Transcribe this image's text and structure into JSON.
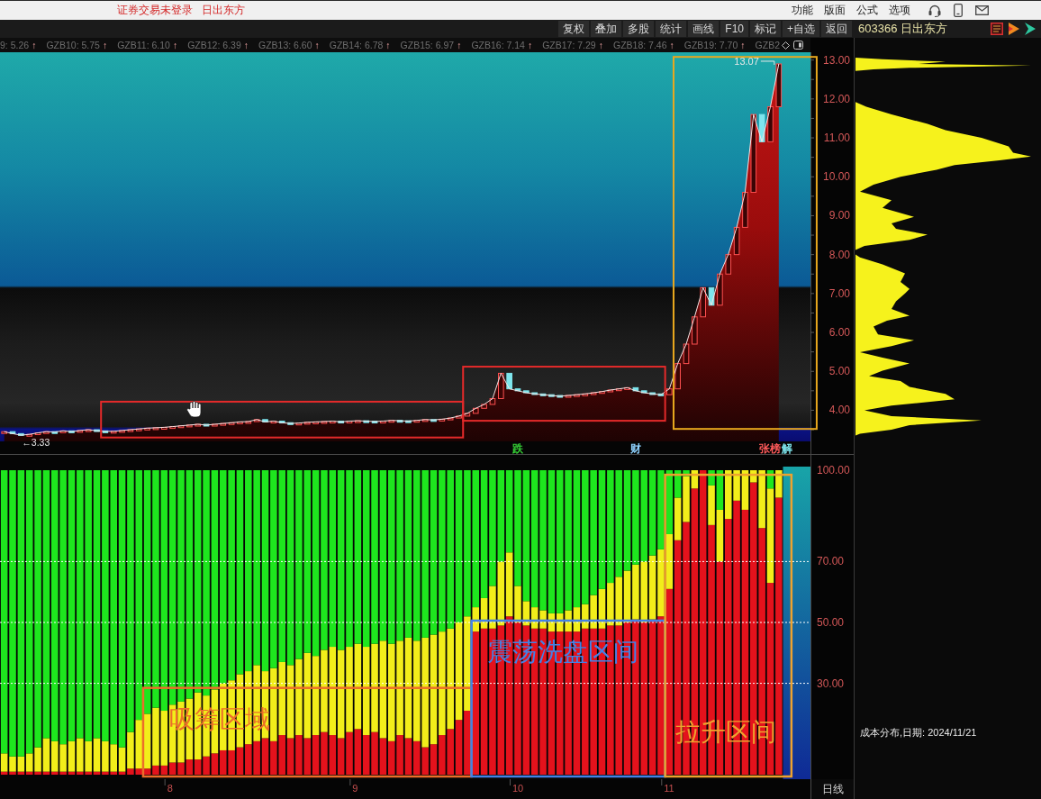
{
  "title_bar": {
    "status": "证券交易未登录",
    "stock_name": "日出东方",
    "menu": [
      "功能",
      "版面",
      "公式",
      "选项"
    ]
  },
  "toolbar": {
    "buttons": [
      "复权",
      "叠加",
      "多股",
      "统计",
      "画线",
      "F10",
      "标记",
      "+自选",
      "返回"
    ]
  },
  "indicator_line": {
    "items": [
      {
        "text": "9: 5.26",
        "arrow": "↑"
      },
      {
        "text": "GZB10: 5.75",
        "arrow": "↑"
      },
      {
        "text": "GZB11: 6.10",
        "arrow": "↑"
      },
      {
        "text": "GZB12: 6.39",
        "arrow": "↑"
      },
      {
        "text": "GZB13: 6.60",
        "arrow": "↑"
      },
      {
        "text": "GZB14: 6.78",
        "arrow": "↑"
      },
      {
        "text": "GZB15: 6.97",
        "arrow": "↑"
      },
      {
        "text": "GZB16: 7.14",
        "arrow": "↑"
      },
      {
        "text": "GZB17: 7.29",
        "arrow": "↑"
      },
      {
        "text": "GZB18: 7.46",
        "arrow": "↑"
      },
      {
        "text": "GZB19: 7.70",
        "arrow": "↑"
      },
      {
        "text": "GZB2"
      }
    ]
  },
  "price_chart": {
    "chart_data": {
      "type": "area",
      "ylim": [
        3.2,
        13.2
      ],
      "yticks": [
        {
          "value": 13,
          "label": "13.00"
        },
        {
          "value": 12,
          "label": "12.00"
        },
        {
          "value": 11,
          "label": "11.00"
        },
        {
          "value": 10,
          "label": "10.00"
        },
        {
          "value": 9,
          "label": "9.00"
        },
        {
          "value": 8,
          "label": "8.00"
        },
        {
          "value": 7,
          "label": "7.00"
        },
        {
          "value": 6,
          "label": "6.00"
        },
        {
          "value": 5,
          "label": "5.00"
        },
        {
          "value": 4,
          "label": "4.00"
        }
      ],
      "series": [
        {
          "color": "#f4e4e4",
          "values": [
            3.45,
            3.4,
            3.36,
            3.38,
            3.42,
            3.45,
            3.44,
            3.47,
            3.45,
            3.48,
            3.5,
            3.47,
            3.46,
            3.46,
            3.48,
            3.5,
            3.52,
            3.54,
            3.55,
            3.56,
            3.58,
            3.6,
            3.62,
            3.64,
            3.62,
            3.64,
            3.66,
            3.68,
            3.7,
            3.71,
            3.76,
            3.7,
            3.72,
            3.68,
            3.66,
            3.67,
            3.69,
            3.7,
            3.71,
            3.72,
            3.7,
            3.72,
            3.73,
            3.72,
            3.71,
            3.72,
            3.74,
            3.73,
            3.72,
            3.74,
            3.76,
            3.75,
            3.77,
            3.8,
            3.85,
            3.92,
            4.05,
            4.15,
            4.3,
            4.95,
            4.55,
            4.5,
            4.45,
            4.42,
            4.4,
            4.38,
            4.36,
            4.38,
            4.4,
            4.42,
            4.45,
            4.48,
            4.52,
            4.55,
            4.58,
            4.5,
            4.45,
            4.42,
            4.4,
            4.55,
            5.2,
            5.7,
            6.4,
            7.15,
            6.7,
            7.5,
            8.0,
            8.7,
            9.6,
            11.6,
            10.9,
            11.8,
            12.9
          ]
        }
      ]
    },
    "high_label": "13.07",
    "low_label": "←3.33",
    "highlight_boxes": [
      {
        "color": "#e42a2a"
      },
      {
        "color": "#e42a2a"
      },
      {
        "color": "#e8a81e"
      }
    ],
    "events": [
      {
        "text": "跌",
        "color": "#36d236"
      },
      {
        "text": "财",
        "color": "#8fd2ff"
      },
      {
        "text": "张榜",
        "color": "#ff5a5a"
      },
      {
        "text": "解",
        "color": "#7fe8f0"
      }
    ]
  },
  "ratio_chart": {
    "chart_data": {
      "type": "bar",
      "stacked": true,
      "grid": true,
      "ylim": [
        0,
        100
      ],
      "yticks": [
        {
          "value": 100,
          "label": "100.00"
        },
        {
          "value": 70,
          "label": "70.00"
        },
        {
          "value": 50,
          "label": "50.00"
        },
        {
          "value": 30,
          "label": "30.00"
        }
      ],
      "series": [
        {
          "color": "#e4121c",
          "values": [
            1,
            1,
            1,
            1,
            1,
            1,
            1,
            1,
            1,
            1,
            1,
            1,
            1,
            1,
            1,
            2,
            2,
            2,
            3,
            3,
            4,
            4,
            5,
            5,
            6,
            7,
            8,
            8,
            9,
            10,
            11,
            12,
            11,
            13,
            12,
            13,
            12,
            13,
            14,
            13,
            12,
            14,
            15,
            13,
            14,
            12,
            11,
            13,
            12,
            11,
            9,
            10,
            13,
            15,
            18,
            21,
            47,
            48,
            48,
            49,
            52,
            50,
            49,
            48,
            48,
            47,
            47,
            47,
            47,
            48,
            48,
            48,
            49,
            49,
            50,
            51,
            50,
            51,
            52,
            61,
            77,
            83,
            94,
            100,
            82,
            70,
            84,
            90,
            87,
            96,
            81,
            63,
            91
          ]
        },
        {
          "color": "#f2ee1a",
          "values": [
            6,
            5,
            5,
            6,
            8,
            11,
            10,
            9,
            10,
            11,
            10,
            11,
            10,
            9,
            8,
            12,
            16,
            18,
            19,
            18,
            19,
            20,
            20,
            22,
            20,
            21,
            22,
            23,
            24,
            24,
            25,
            22,
            24,
            24,
            24,
            25,
            28,
            26,
            27,
            29,
            29,
            28,
            28,
            29,
            29,
            32,
            32,
            31,
            33,
            33,
            36,
            36,
            34,
            33,
            32,
            31,
            8,
            10,
            14,
            21,
            21,
            12,
            8,
            7,
            6,
            6,
            6,
            7,
            8,
            8,
            11,
            13,
            14,
            16,
            17,
            18,
            20,
            21,
            22,
            18,
            14,
            15,
            6,
            0,
            13,
            17,
            16,
            10,
            13,
            4,
            19,
            31,
            9
          ]
        },
        {
          "color": "#1ee61e",
          "values": [
            93,
            94,
            94,
            93,
            91,
            88,
            89,
            90,
            89,
            88,
            89,
            88,
            89,
            90,
            91,
            86,
            82,
            80,
            78,
            79,
            77,
            76,
            75,
            73,
            74,
            72,
            70,
            69,
            67,
            66,
            64,
            66,
            65,
            63,
            64,
            62,
            60,
            61,
            59,
            58,
            59,
            58,
            57,
            58,
            57,
            56,
            57,
            56,
            55,
            56,
            55,
            54,
            53,
            52,
            50,
            48,
            45,
            42,
            38,
            30,
            27,
            38,
            43,
            45,
            46,
            47,
            47,
            46,
            45,
            44,
            41,
            39,
            37,
            35,
            33,
            31,
            30,
            28,
            26,
            21,
            9,
            2,
            0,
            0,
            5,
            13,
            0,
            0,
            0,
            0,
            0,
            6,
            0
          ]
        }
      ]
    },
    "zones": [
      {
        "label": "吸筹区域",
        "color": "#ec6e2a"
      },
      {
        "label": "震荡洗盘区间",
        "color": "#4382e6"
      },
      {
        "label": "拉升区间",
        "color": "#eea22e"
      }
    ],
    "month_labels": [
      "8",
      "9",
      "10",
      "11"
    ]
  },
  "period_button": "日线",
  "side_panel": {
    "stock": "603366 日出东方",
    "caption": "成本分布,日期: 2024/11/21"
  }
}
